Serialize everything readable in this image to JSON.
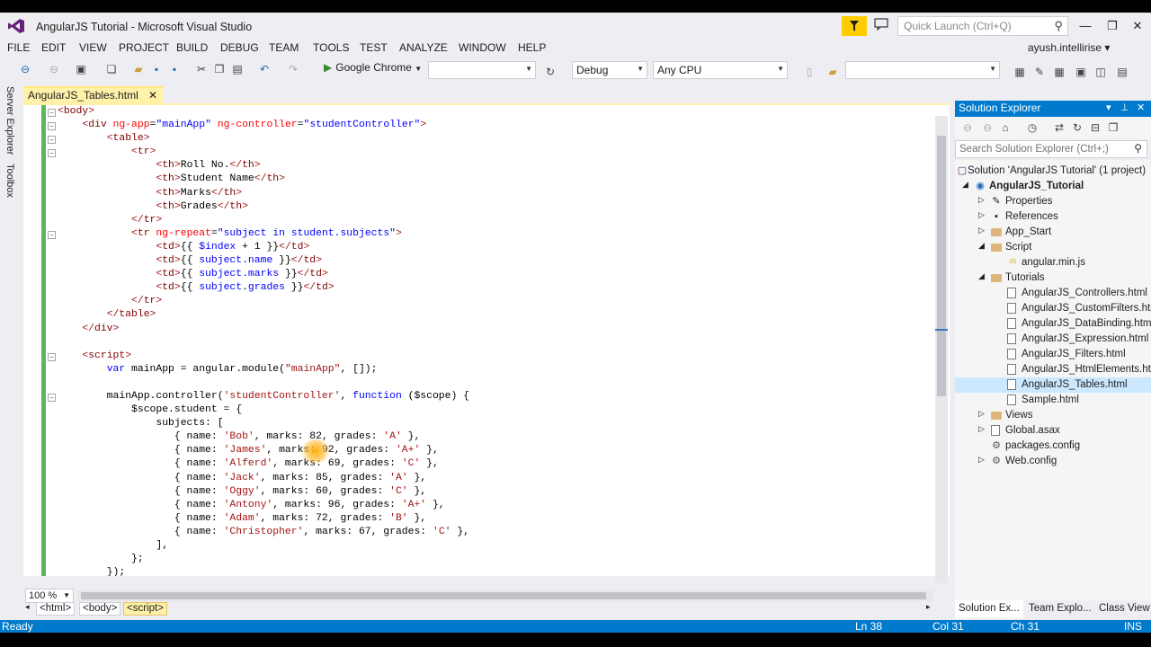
{
  "window": {
    "title": "AngularJS Tutorial - Microsoft Visual Studio",
    "quick_launch_placeholder": "Quick Launch (Ctrl+Q)",
    "user": "ayush.intellirise",
    "user_caret": "▾"
  },
  "menu": [
    "FILE",
    "EDIT",
    "VIEW",
    "PROJECT",
    "BUILD",
    "DEBUG",
    "TEAM",
    "TOOLS",
    "TEST",
    "ANALYZE",
    "WINDOW",
    "HELP"
  ],
  "toolbar": {
    "run_target": "Google Chrome",
    "configuration": "Debug",
    "platform": "Any CPU",
    "empty_combo": "",
    "find_combo": ""
  },
  "side_strip": [
    "Server Explorer",
    "Toolbox"
  ],
  "editor": {
    "tab_label": "AngularJS_Tables.html",
    "tab_close": "✕",
    "zoom": "100 %",
    "breadcrumbs": [
      "<html>",
      "<body>",
      "<script>"
    ]
  },
  "code_lines": [
    "<body>",
    "    <div ng-app=\"mainApp\" ng-controller=\"studentController\">",
    "        <table>",
    "            <tr>",
    "                <th>Roll No.</th>",
    "                <th>Student Name</th>",
    "                <th>Marks</th>",
    "                <th>Grades</th>",
    "            </tr>",
    "            <tr ng-repeat=\"subject in student.subjects\">",
    "                <td>{{ $index + 1 }}</td>",
    "                <td>{{ subject.name }}</td>",
    "                <td>{{ subject.marks }}</td>",
    "                <td>{{ subject.grades }}</td>",
    "            </tr>",
    "        </table>",
    "    </div>",
    "",
    "    <script>",
    "        var mainApp = angular.module(\"mainApp\", []);",
    "",
    "        mainApp.controller('studentController', function ($scope) {",
    "            $scope.student = {",
    "                subjects: [",
    "                   { name: 'Bob', marks: 82, grades: 'A' },",
    "                   { name: 'James', marks: 92, grades: 'A+' },",
    "                   { name: 'Alferd', marks: 69, grades: 'C' },",
    "                   { name: 'Jack', marks: 85, grades: 'A' },",
    "                   { name: 'Oggy', marks: 60, grades: 'C' },",
    "                   { name: 'Antony', marks: 96, grades: 'A+' },",
    "                   { name: 'Adam', marks: 72, grades: 'B' },",
    "                   { name: 'Christopher', marks: 67, grades: 'C' },",
    "                ],",
    "            };",
    "        });"
  ],
  "solution_explorer": {
    "title": "Solution Explorer",
    "search_placeholder": "Search Solution Explorer (Ctrl+;)",
    "tree": [
      {
        "label": "Solution 'AngularJS Tutorial' (1 project)",
        "depth": 0,
        "icon": "solution",
        "arrow": ""
      },
      {
        "label": "AngularJS_Tutorial",
        "depth": 0,
        "icon": "project",
        "arrow": "◢",
        "bold": true
      },
      {
        "label": "Properties",
        "depth": 1,
        "icon": "wrench",
        "arrow": "▷"
      },
      {
        "label": "References",
        "depth": 1,
        "icon": "references",
        "arrow": "▷"
      },
      {
        "label": "App_Start",
        "depth": 1,
        "icon": "folder",
        "arrow": "▷"
      },
      {
        "label": "Script",
        "depth": 1,
        "icon": "folder",
        "arrow": "◢"
      },
      {
        "label": "angular.min.js",
        "depth": 2,
        "icon": "js",
        "arrow": ""
      },
      {
        "label": "Tutorials",
        "depth": 1,
        "icon": "folder",
        "arrow": "◢"
      },
      {
        "label": "AngularJS_Controllers.html",
        "depth": 2,
        "icon": "file",
        "arrow": ""
      },
      {
        "label": "AngularJS_CustomFilters.html",
        "depth": 2,
        "icon": "file",
        "arrow": ""
      },
      {
        "label": "AngularJS_DataBinding.html",
        "depth": 2,
        "icon": "file",
        "arrow": ""
      },
      {
        "label": "AngularJS_Expression.html",
        "depth": 2,
        "icon": "file",
        "arrow": ""
      },
      {
        "label": "AngularJS_Filters.html",
        "depth": 2,
        "icon": "file",
        "arrow": ""
      },
      {
        "label": "AngularJS_HtmlElements.html",
        "depth": 2,
        "icon": "file",
        "arrow": ""
      },
      {
        "label": "AngularJS_Tables.html",
        "depth": 2,
        "icon": "file",
        "arrow": "",
        "selected": true
      },
      {
        "label": "Sample.html",
        "depth": 2,
        "icon": "file",
        "arrow": ""
      },
      {
        "label": "Views",
        "depth": 1,
        "icon": "folder",
        "arrow": "▷"
      },
      {
        "label": "Global.asax",
        "depth": 1,
        "icon": "file",
        "arrow": "▷"
      },
      {
        "label": "packages.config",
        "depth": 1,
        "icon": "config",
        "arrow": ""
      },
      {
        "label": "Web.config",
        "depth": 1,
        "icon": "config",
        "arrow": "▷"
      }
    ],
    "tabs": [
      "Solution Ex...",
      "Team Explo...",
      "Class View"
    ]
  },
  "status": {
    "state": "Ready",
    "line": "Ln 38",
    "col": "Col 31",
    "ch": "Ch 31",
    "mode": "INS"
  },
  "colors": {
    "accent": "#007acc",
    "notification": "#ffcc00",
    "active_tab": "#fff1a8",
    "change_bar": "#58b85a"
  }
}
